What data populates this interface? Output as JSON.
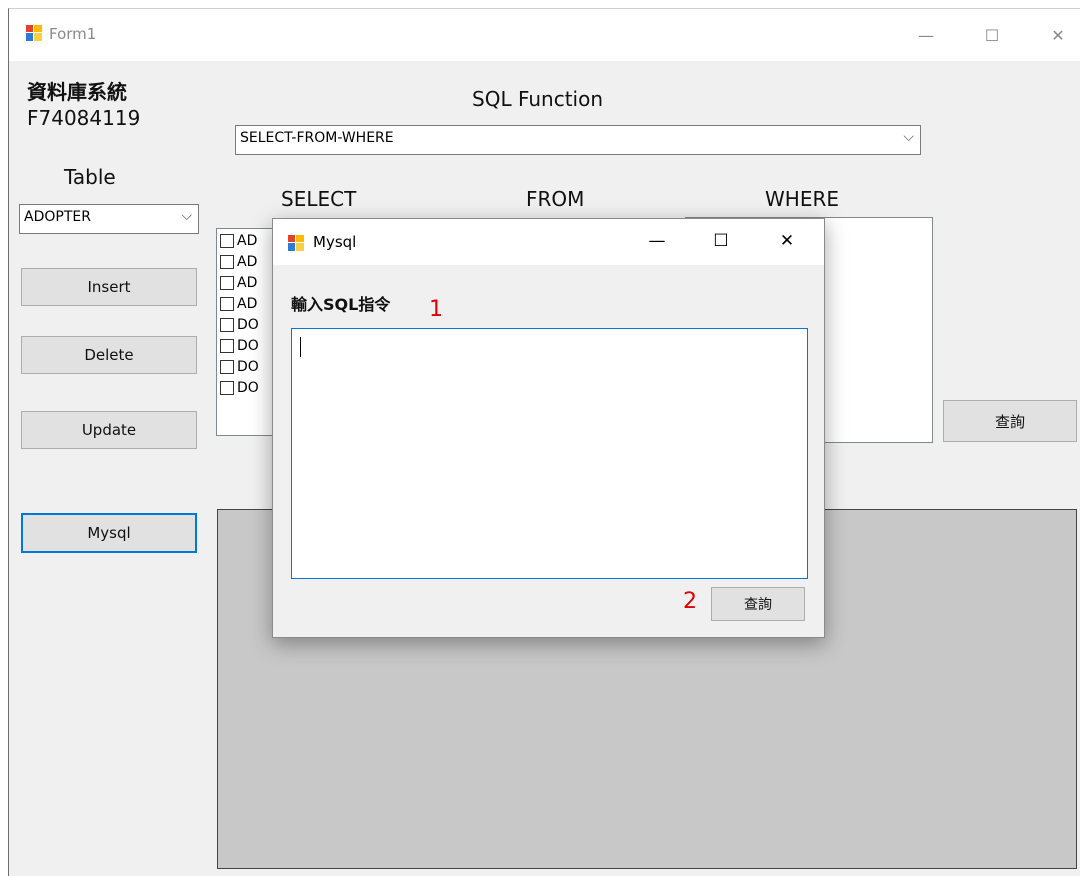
{
  "main_window": {
    "title": "Form1",
    "title_buttons": {
      "minimize": "—",
      "maximize": "☐",
      "close": "✕"
    },
    "header_line1": "資料庫系統",
    "header_line2": "F74084119",
    "sql_function_label": "SQL Function",
    "sql_function_value": "SELECT-FROM-WHERE",
    "table_label": "Table",
    "table_value": "ADOPTER",
    "buttons": {
      "insert": "Insert",
      "delete": "Delete",
      "update": "Update",
      "mysql": "Mysql",
      "query": "查詢"
    },
    "column_headers": {
      "select": "SELECT",
      "from": "FROM",
      "where": "WHERE"
    },
    "select_items": [
      "AD",
      "AD",
      "AD",
      "AD",
      "DO",
      "DO",
      "DO",
      "DO"
    ]
  },
  "dialog": {
    "title": "Mysql",
    "title_buttons": {
      "minimize": "—",
      "maximize": "☐",
      "close": "✕"
    },
    "prompt_label": "輸入SQL指令",
    "sql_input_value": "",
    "query_button": "查詢",
    "annotation_1": "1",
    "annotation_2": "2"
  },
  "colors": {
    "annotation": "#e00000",
    "focus_border": "#0078d7",
    "window_bg": "#f0f0f0",
    "result_area": "#c8c8c8"
  },
  "icons": {
    "app": "windows-forms-app-icon",
    "checkbox": "checkbox-unchecked-icon",
    "dropdown": "chevron-down-icon"
  }
}
